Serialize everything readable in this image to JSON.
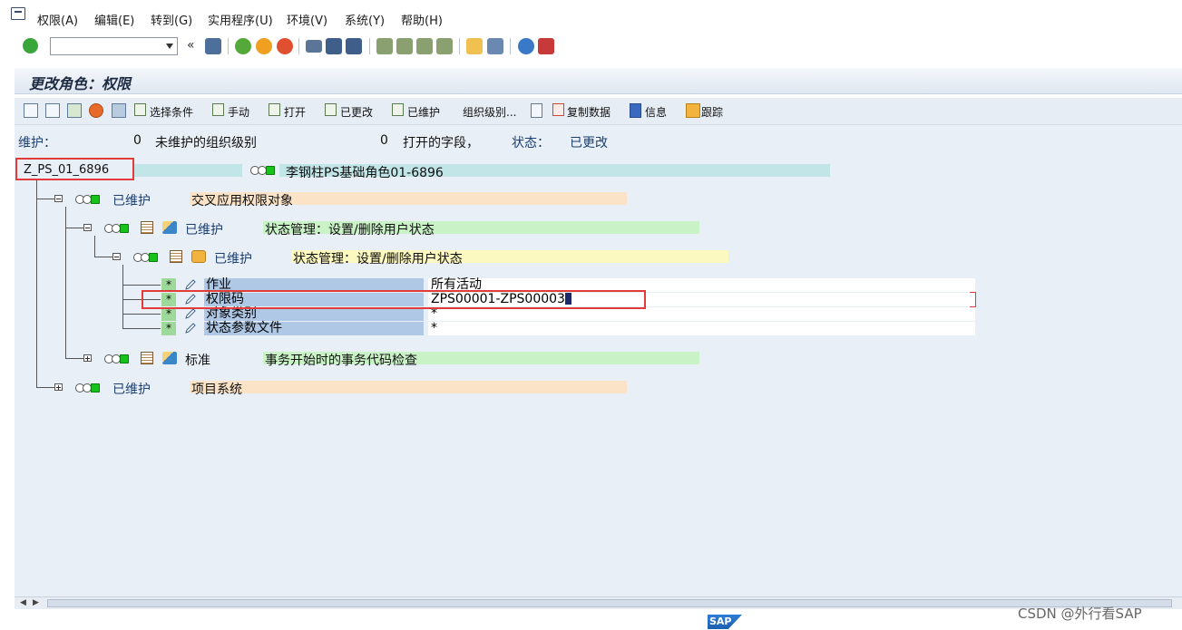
{
  "menu": {
    "items": [
      "权限(A)",
      "编辑(E)",
      "转到(G)",
      "实用程序(U)",
      "环境(V)",
      "系统(Y)",
      "帮助(H)"
    ]
  },
  "toolbar": {
    "command_value": "",
    "back_symbol": "«"
  },
  "page": {
    "title": "更改角色：权限"
  },
  "app_toolbar": {
    "select_criteria": "选择条件",
    "manual": "手动",
    "open": "打开",
    "changed": "已更改",
    "maintained": "已维护",
    "org_levels": "组织级别...",
    "copy_data": "复制数据",
    "info": "信息",
    "trace": "跟踪"
  },
  "status": {
    "maintain_label": "维护：",
    "unmaintained_org_count": "0",
    "unmaintained_org_label": "未维护的组织级别",
    "open_fields_count": "0",
    "open_fields_label": "打开的字段，",
    "state_label": "状态：",
    "state_value": "已更改"
  },
  "tree": {
    "root": {
      "role": "Z_PS_01_6896",
      "description": "李钢柱PS基础角色01-6896"
    },
    "l1a": {
      "status": "已维护",
      "text": "交叉应用权限对象"
    },
    "l2a": {
      "status": "已维护",
      "text": "状态管理：设置/删除用户状态"
    },
    "l3a": {
      "status": "已维护",
      "text": "状态管理：设置/删除用户状态"
    },
    "fields": [
      {
        "star": "*",
        "label": "作业",
        "value": "所有活动"
      },
      {
        "star": "*",
        "label": "权限码",
        "value": "ZPS00001-ZPS00003"
      },
      {
        "star": "*",
        "label": "对象类别",
        "value": "*"
      },
      {
        "star": "*",
        "label": "状态参数文件",
        "value": "*"
      }
    ],
    "l2b": {
      "status": "标准",
      "text": "事务开始时的事务代码检查"
    },
    "l1b": {
      "status": "已维护",
      "text": "项目系统"
    }
  },
  "footer": {
    "sap": "SAP",
    "watermark": "CSDN @外行看SAP"
  },
  "colors": {
    "tree_cyan": "#c2e5e8",
    "tree_orange": "#fbe3c8",
    "tree_green": "#c9f2c6",
    "tree_yellow": "#fbf8c0",
    "highlight_red": "#e33a3a",
    "status_green": "#17c21a"
  }
}
